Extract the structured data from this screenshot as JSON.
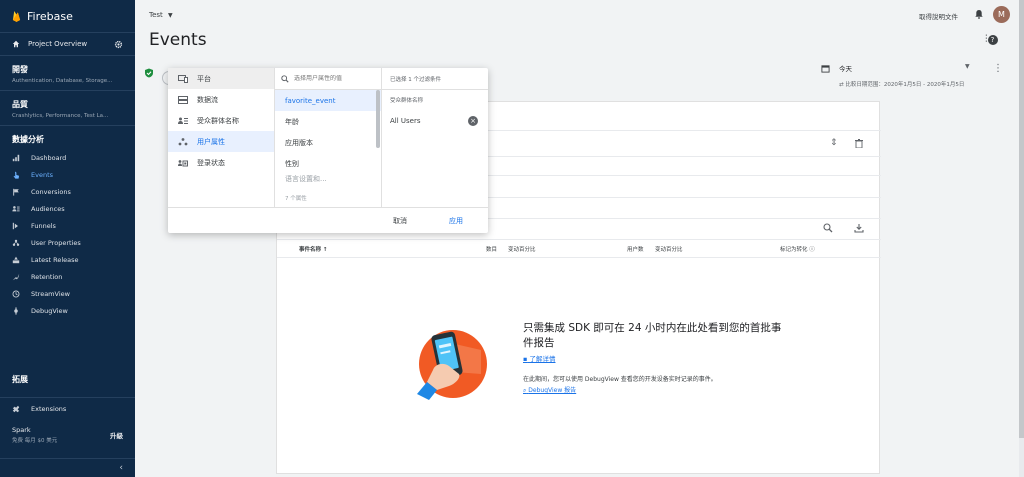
{
  "sidebar": {
    "brand": "Firebase",
    "project_overview": "Project Overview",
    "groups": [
      {
        "title": "開發",
        "subtitle": "Authentication, Database, Storage..."
      },
      {
        "title": "品質",
        "subtitle": "Crashlytics, Performance, Test La..."
      }
    ],
    "analytics_title": "數據分析",
    "items": [
      {
        "label": "Dashboard",
        "icon": "bar-chart-icon"
      },
      {
        "label": "Events",
        "icon": "touch-icon",
        "active": true
      },
      {
        "label": "Conversions",
        "icon": "flag-icon"
      },
      {
        "label": "Audiences",
        "icon": "audience-icon"
      },
      {
        "label": "Funnels",
        "icon": "funnel-icon"
      },
      {
        "label": "User Properties",
        "icon": "user-properties-icon"
      },
      {
        "label": "Latest Release",
        "icon": "release-icon"
      },
      {
        "label": "Retention",
        "icon": "retention-icon"
      },
      {
        "label": "StreamView",
        "icon": "clock-icon"
      },
      {
        "label": "DebugView",
        "icon": "debug-icon"
      }
    ],
    "extend_title": "拓展",
    "extensions": "Extensions",
    "plan_name": "Spark",
    "plan_desc": "免费 每月 $0 美元",
    "upgrade": "升級",
    "collapse": "‹"
  },
  "topbar": {
    "project": "Test",
    "docs": "取得說明文件",
    "avatar": "M"
  },
  "page": {
    "title": "Events",
    "date": {
      "label": "今天",
      "compare": "比較日期范围：2020年1月5日 - 2020年1月5日"
    }
  },
  "filter_popup": {
    "left_items": [
      {
        "label": "平台",
        "icon": "device-icon"
      },
      {
        "label": "数据流",
        "icon": "stream-icon"
      },
      {
        "label": "受众群体名称",
        "icon": "audience-name-icon"
      },
      {
        "label": "用户属性",
        "icon": "user-property-icon"
      },
      {
        "label": "登录状态",
        "icon": "login-status-icon"
      }
    ],
    "search_placeholder": "选择用户属性的值",
    "mid_items": [
      "favorite_event",
      "年龄",
      "应用版本",
      "性别",
      "语言设置和..."
    ],
    "count": "7 个属性",
    "right_header": "已选择 1 个过滤条件",
    "right_sub": "受众群体名称",
    "right_value": "All Users",
    "cancel": "取消",
    "apply": "应用"
  },
  "table": {
    "headers": {
      "event_name": "事件名称 ↑",
      "count": "数目",
      "count_change": "变动百分比",
      "users": "用户数",
      "users_change": "变动百分比",
      "conversion": "标记为转化 ⓘ"
    }
  },
  "empty_state": {
    "title": "只需集成 SDK 即可在 24 小时内在此处看到您的首批事件报告",
    "learn_more": "了解详情",
    "desc": "在此期间，您可以使用 DebugView 查看您的开发设备实时记录的事件。",
    "debug_link": "DebugView 报告"
  },
  "colors": {
    "sidebar_bg": "#0f2a47",
    "accent": "#1a73e8",
    "active_item": "#6cb1ff",
    "illustration": "#f15a24"
  }
}
